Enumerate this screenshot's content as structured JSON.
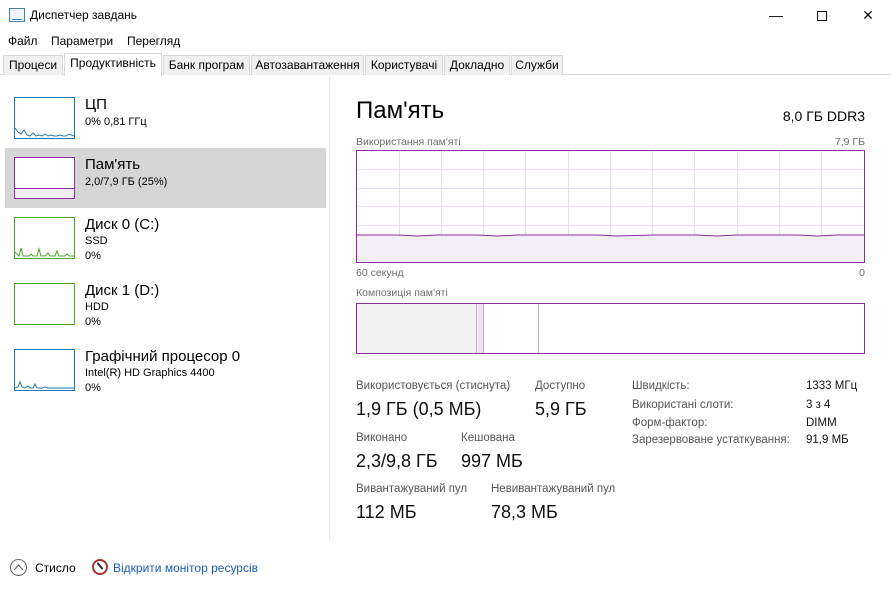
{
  "window": {
    "title": "Диспетчер завдань",
    "controls": {
      "minimize_glyph": "—",
      "close_glyph": "✕"
    }
  },
  "menu": [
    "Файл",
    "Параметри",
    "Перегляд"
  ],
  "tabs": [
    {
      "label": "Процеси",
      "active": false
    },
    {
      "label": "Продуктивність",
      "active": true
    },
    {
      "label": "Банк програм",
      "active": false
    },
    {
      "label": "Автозавантаження",
      "active": false
    },
    {
      "label": "Користувачі",
      "active": false
    },
    {
      "label": "Докладно",
      "active": false
    },
    {
      "label": "Служби",
      "active": false
    }
  ],
  "sidebar": {
    "items": [
      {
        "title": "ЦП",
        "line1": "0% 0,81 ГГц",
        "line2": "",
        "color": "#1f77b4",
        "selected": false
      },
      {
        "title": "Пам'ять",
        "line1": "2,0/7,9 ГБ (25%)",
        "line2": "",
        "color": "#8b2f9c",
        "selected": true,
        "fill_fraction": 0.25
      },
      {
        "title": "Диск 0 (C:)",
        "line1": "SSD",
        "line2": "0%",
        "color": "#4da329",
        "selected": false
      },
      {
        "title": "Диск 1 (D:)",
        "line1": "HDD",
        "line2": "0%",
        "color": "#4da329",
        "selected": false
      },
      {
        "title": "Графічний процесор 0",
        "line1": "Intel(R) HD Graphics 4400",
        "line2": "0%",
        "color": "#1f77b4",
        "selected": false
      }
    ]
  },
  "main": {
    "title": "Пам'ять",
    "subtitle": "8,0 ГБ DDR3",
    "usage_label": "Використання пам'яті",
    "usage_max": "7,9 ГБ",
    "time_left": "60 секунд",
    "time_right": "0",
    "composition_label": "Композиція пам'яті",
    "accent_color": "#8b2f9c",
    "usage_level_fraction": 0.25,
    "stats": {
      "in_use_label": "Використовується (стиснута)",
      "in_use_value": "1,9 ГБ (0,5 МБ)",
      "available_label": "Доступно",
      "available_value": "5,9 ГБ",
      "committed_label": "Виконано",
      "committed_value": "2,3/9,8 ГБ",
      "cached_label": "Кешована",
      "cached_value": "997 МБ",
      "paged_label": "Вивантажуваний пул",
      "paged_value": "112 МБ",
      "nonpaged_label": "Невивантажуваний пул",
      "nonpaged_value": "78,3 МБ"
    },
    "specs": [
      {
        "label": "Швидкість:",
        "value": "1333 МГц"
      },
      {
        "label": "Використані слоти:",
        "value": "3 з 4"
      },
      {
        "label": "Форм-фактор:",
        "value": "DIMM"
      },
      {
        "label": "Зарезервоване устаткування:",
        "value": "91,9 МБ"
      }
    ]
  },
  "footer": {
    "fewer_details": "Стисло",
    "resource_monitor": "Відкрити монітор ресурсів"
  }
}
